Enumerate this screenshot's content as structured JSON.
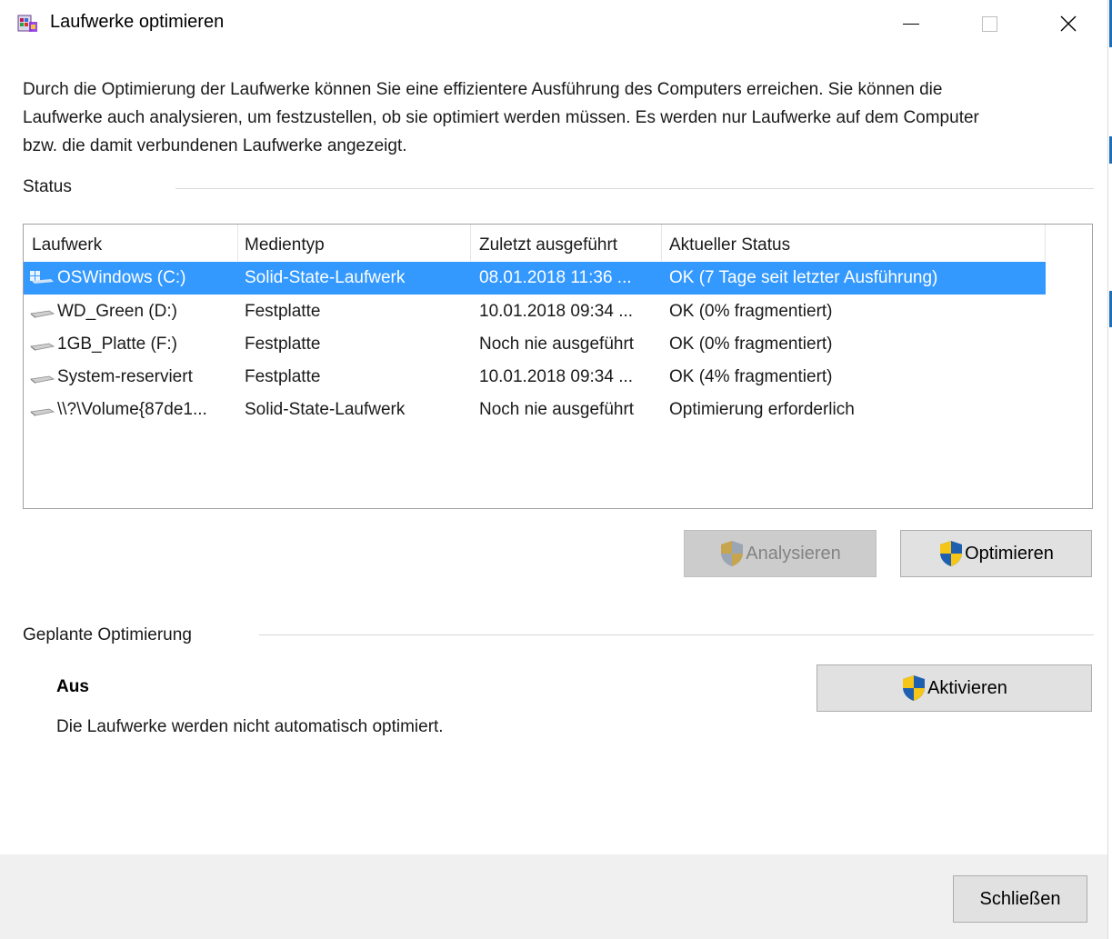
{
  "window": {
    "title": "Laufwerke optimieren"
  },
  "intro_text": "Durch die Optimierung der Laufwerke können Sie eine effizientere Ausführung des Computers erreichen. Sie können die Laufwerke auch analysieren, um festzustellen, ob sie optimiert werden müssen. Es werden nur Laufwerke auf dem Computer bzw. die damit verbundenen Laufwerke angezeigt.",
  "status_section": {
    "label": "Status",
    "columns": [
      "Laufwerk",
      "Medientyp",
      "Zuletzt ausgeführt",
      "Aktueller Status"
    ],
    "rows": [
      {
        "drive": "OSWindows (C:)",
        "media": "Solid-State-Laufwerk",
        "last_run": "08.01.2018 11:36 ...",
        "status": "OK (7 Tage seit letzter Ausführung)",
        "selected": true,
        "icon": "windows-drive-icon"
      },
      {
        "drive": "WD_Green (D:)",
        "media": "Festplatte",
        "last_run": "10.01.2018 09:34 ...",
        "status": "OK (0% fragmentiert)",
        "selected": false,
        "icon": "hard-drive-icon"
      },
      {
        "drive": "1GB_Platte (F:)",
        "media": "Festplatte",
        "last_run": "Noch nie ausgeführt",
        "status": "OK (0% fragmentiert)",
        "selected": false,
        "icon": "hard-drive-icon"
      },
      {
        "drive": "System-reserviert",
        "media": "Festplatte",
        "last_run": "10.01.2018 09:34 ...",
        "status": "OK (4% fragmentiert)",
        "selected": false,
        "icon": "hard-drive-icon"
      },
      {
        "drive": "\\\\?\\Volume{87de1...",
        "media": "Solid-State-Laufwerk",
        "last_run": "Noch nie ausgeführt",
        "status": "Optimierung erforderlich",
        "selected": false,
        "icon": "hard-drive-icon"
      }
    ],
    "analyze_button": "Analysieren",
    "optimize_button": "Optimieren"
  },
  "schedule_section": {
    "label": "Geplante Optimierung",
    "state": "Aus",
    "description": "Die Laufwerke werden nicht automatisch optimiert.",
    "activate_button": "Aktivieren"
  },
  "footer": {
    "close_button": "Schließen"
  },
  "colors": {
    "selection": "#3399ff",
    "shield_blue": "#1f5fb0",
    "shield_yellow": "#f5c518"
  }
}
